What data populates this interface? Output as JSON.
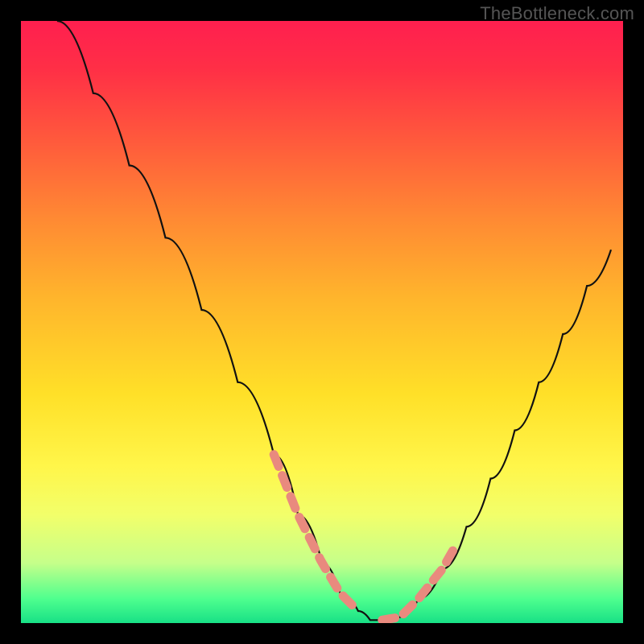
{
  "watermark": "TheBottleneck.com",
  "chart_data": {
    "type": "line",
    "title": "",
    "xlabel": "",
    "ylabel": "",
    "xlim": [
      0,
      100
    ],
    "ylim": [
      0,
      100
    ],
    "grid": false,
    "legend": false,
    "series": [
      {
        "name": "bottleneck-curve",
        "x": [
          6,
          12,
          18,
          24,
          30,
          36,
          42,
          46,
          50,
          53,
          56,
          58,
          60,
          63,
          66,
          70,
          74,
          78,
          82,
          86,
          90,
          94,
          98
        ],
        "y": [
          100,
          88,
          76,
          64,
          52,
          40,
          28,
          18,
          10,
          5,
          2,
          0.5,
          0.5,
          1,
          4,
          9,
          16,
          24,
          32,
          40,
          48,
          56,
          62
        ]
      }
    ],
    "highlight_xrange_left": [
      42,
      56
    ],
    "highlight_xrange_right": [
      60,
      72
    ],
    "colors": {
      "curve": "#111111",
      "highlight": "#e98a7e"
    }
  }
}
